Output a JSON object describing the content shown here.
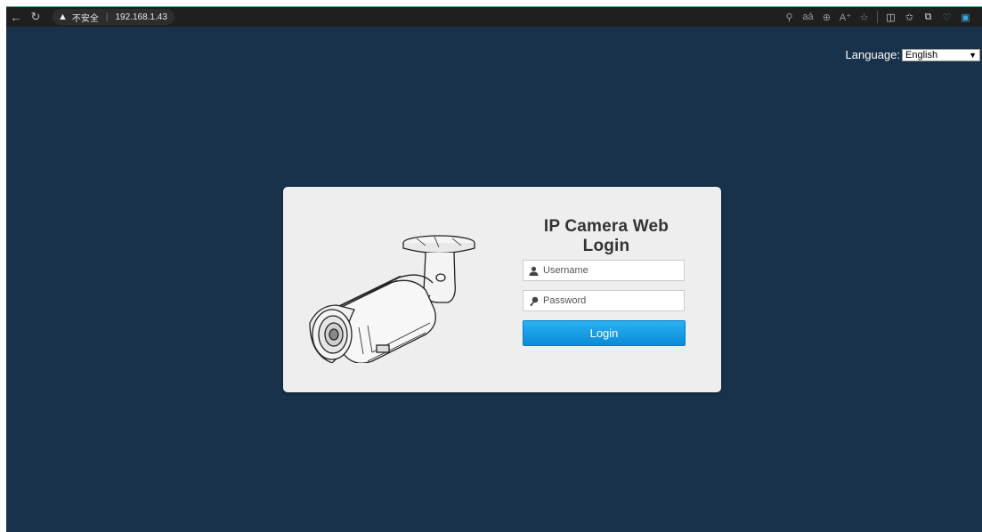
{
  "browser": {
    "security_label": "不安全",
    "address": "192.168.1.43",
    "nav_icons": [
      "back-arrow-icon",
      "refresh-icon"
    ],
    "toolbar_icons": [
      "key-icon",
      "translate-icon",
      "zoom-icon",
      "read-aloud-icon",
      "favorite-star-icon",
      "split-screen-icon",
      "favorites-icon",
      "collections-icon",
      "browser-essentials-icon",
      "outlook-icon"
    ]
  },
  "language": {
    "label": "Language:",
    "selected": "English"
  },
  "login": {
    "title": "IP Camera Web Login",
    "username_placeholder": "Username",
    "password_placeholder": "Password",
    "button_label": "Login"
  },
  "colors": {
    "page_background": "#17324a",
    "card_background": "#eeeeee",
    "button_blue": "#1a9de4"
  }
}
